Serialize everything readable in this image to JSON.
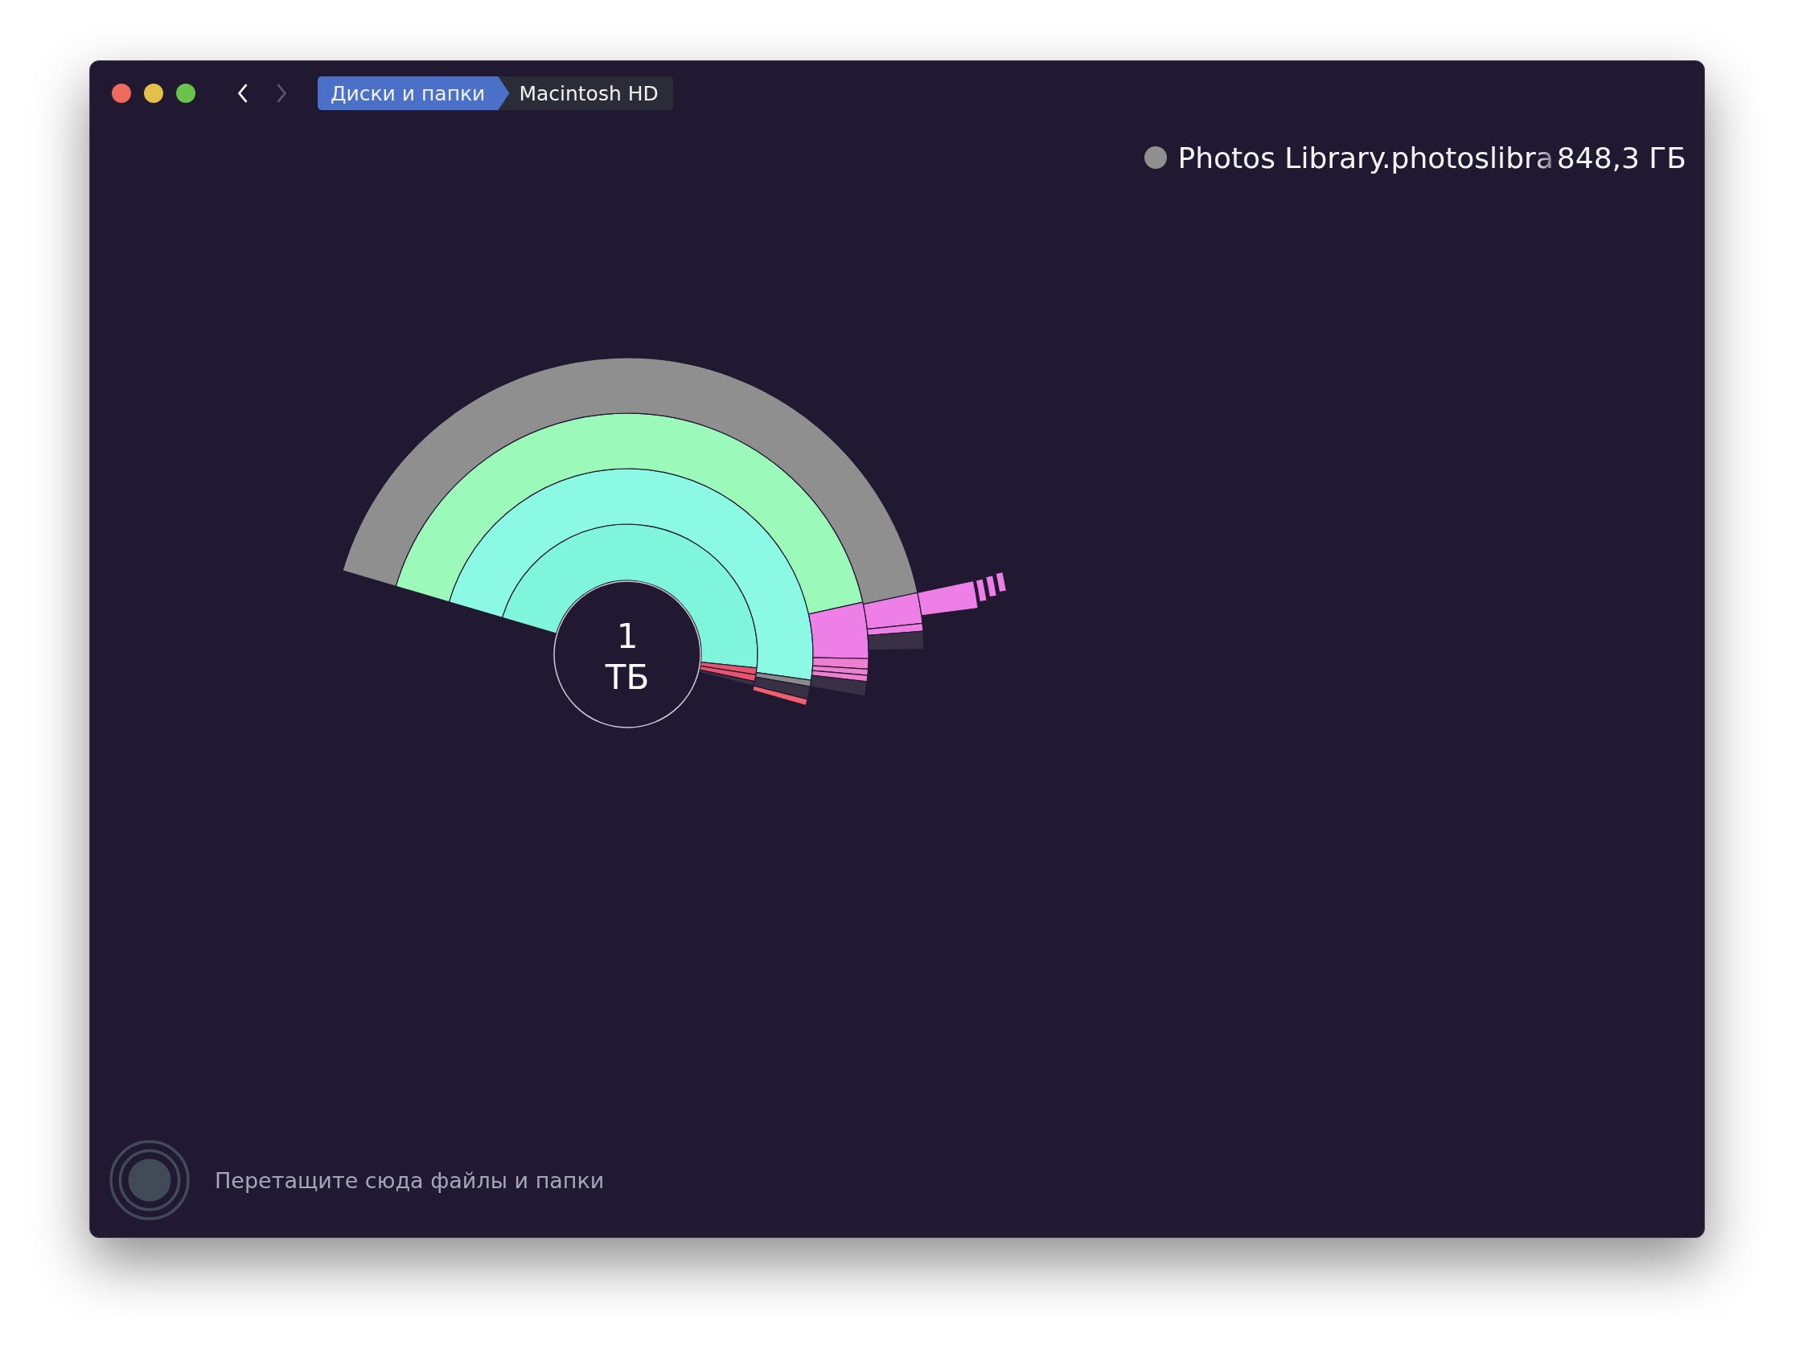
{
  "window": {
    "nav": {
      "back": {
        "disabled": false
      },
      "forward": {
        "disabled": true
      }
    }
  },
  "breadcrumbs": [
    {
      "label": "Диски и папки",
      "selected": true
    },
    {
      "label": "Macintosh HD",
      "selected": false
    }
  ],
  "hover_info": {
    "name": "Photos Library.photoslibra",
    "size": "848,3 ГБ"
  },
  "chart_center": {
    "value": "1",
    "unit": "ТБ"
  },
  "drop_zone": {
    "hint": "Перетащите сюда файлы и папки"
  }
}
